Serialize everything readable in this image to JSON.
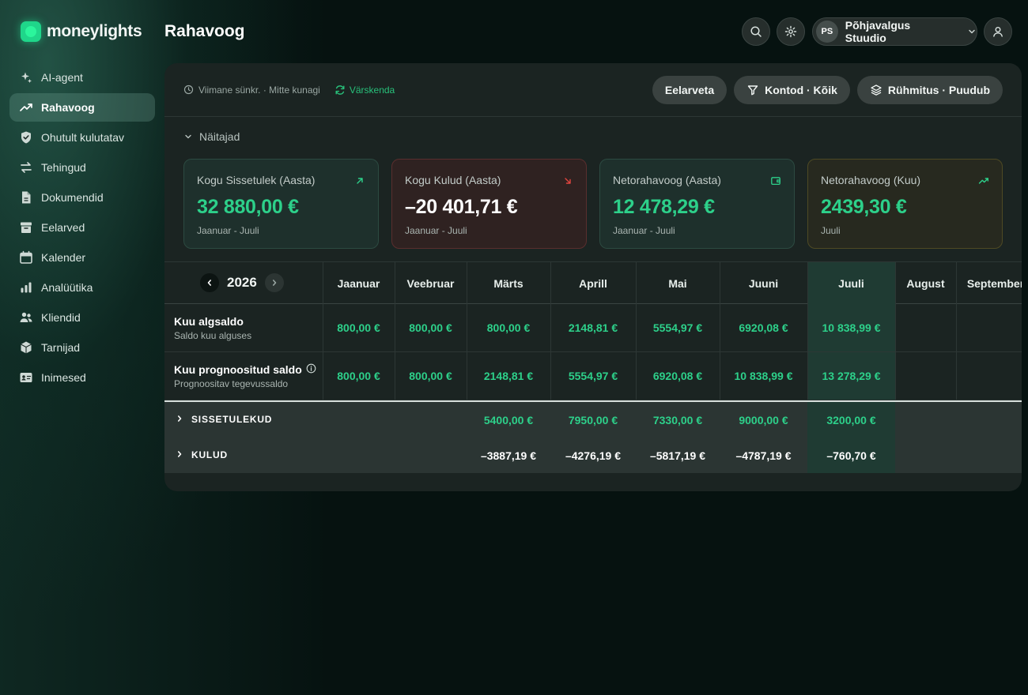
{
  "app": {
    "name": "moneylights"
  },
  "sidebar": {
    "items": [
      {
        "label": "AI-agent",
        "icon": "sparkles-icon",
        "active": false
      },
      {
        "label": "Rahavoog",
        "icon": "trending-up-icon",
        "active": true
      },
      {
        "label": "Ohutult kulutatav",
        "icon": "shield-check-icon",
        "active": false
      },
      {
        "label": "Tehingud",
        "icon": "arrows-swap-icon",
        "active": false
      },
      {
        "label": "Dokumendid",
        "icon": "document-icon",
        "active": false
      },
      {
        "label": "Eelarved",
        "icon": "archive-box-icon",
        "active": false
      },
      {
        "label": "Kalender",
        "icon": "calendar-icon",
        "active": false
      },
      {
        "label": "Analüütika",
        "icon": "bar-chart-icon",
        "active": false
      },
      {
        "label": "Kliendid",
        "icon": "users-icon",
        "active": false
      },
      {
        "label": "Tarnijad",
        "icon": "cube-icon",
        "active": false
      },
      {
        "label": "Inimesed",
        "icon": "id-card-icon",
        "active": false
      }
    ]
  },
  "header": {
    "title": "Rahavoog",
    "org": {
      "initials": "PS",
      "name": "Põhjavalgus Stuudio"
    }
  },
  "toolbar": {
    "sync_text": "Viimane sünkr. · Mitte kunagi",
    "refresh_label": "Värskenda",
    "budget_btn": "Eelarveta",
    "accounts_btn": "Kontod · Kõik",
    "grouping_btn": "Rühmitus · Puudub"
  },
  "indicators": {
    "toggle_label": "Näitajad",
    "cards": [
      {
        "title": "Kogu Sissetulek (Aasta)",
        "value": "32 880,00 €",
        "period": "Jaanuar - Juuli",
        "tone": "green",
        "icon": "arrow-up-right-icon",
        "sign": "pos"
      },
      {
        "title": "Kogu Kulud (Aasta)",
        "value": "–20 401,71 €",
        "period": "Jaanuar - Juuli",
        "tone": "red",
        "icon": "arrow-down-right-icon",
        "sign": "neg"
      },
      {
        "title": "Netorahavoog (Aasta)",
        "value": "12 478,29 €",
        "period": "Jaanuar - Juuli",
        "tone": "green",
        "icon": "wallet-icon",
        "sign": "pos"
      },
      {
        "title": "Netorahavoog (Kuu)",
        "value": "2439,30 €",
        "period": "Juuli",
        "tone": "amber",
        "icon": "trending-up-icon",
        "sign": "pos"
      }
    ]
  },
  "table": {
    "year": "2026",
    "months": [
      "Jaanuar",
      "Veebruar",
      "Märts",
      "Aprill",
      "Mai",
      "Juuni",
      "Juuli",
      "August",
      "September"
    ],
    "rows": [
      {
        "title": "Kuu algsaldo",
        "subtitle": "Saldo kuu alguses",
        "info": false,
        "values": [
          "800,00 €",
          "800,00 €",
          "800,00 €",
          "2148,81 €",
          "5554,97 €",
          "6920,08 €",
          "10 838,99 €",
          "",
          ""
        ]
      },
      {
        "title": "Kuu prognoositud saldo",
        "subtitle": "Prognoositav tegevussaldo",
        "info": true,
        "values": [
          "800,00 €",
          "800,00 €",
          "2148,81 €",
          "5554,97 €",
          "6920,08 €",
          "10 838,99 €",
          "13 278,29 €",
          "",
          ""
        ]
      }
    ],
    "groups": [
      {
        "label": "SISSETULEKUD",
        "sign": "pos",
        "values": [
          "",
          "",
          "5400,00 €",
          "7950,00 €",
          "7330,00 €",
          "9000,00 €",
          "3200,00 €",
          "",
          ""
        ]
      },
      {
        "label": "KULUD",
        "sign": "neg",
        "values": [
          "",
          "",
          "–3887,19 €",
          "–4276,19 €",
          "–5817,19 €",
          "–4787,19 €",
          "–760,70 €",
          "",
          ""
        ]
      }
    ]
  },
  "colors": {
    "accent": "#2dd08a",
    "negative_border": "#5a2e2e",
    "active_column": "#1f3b33"
  }
}
